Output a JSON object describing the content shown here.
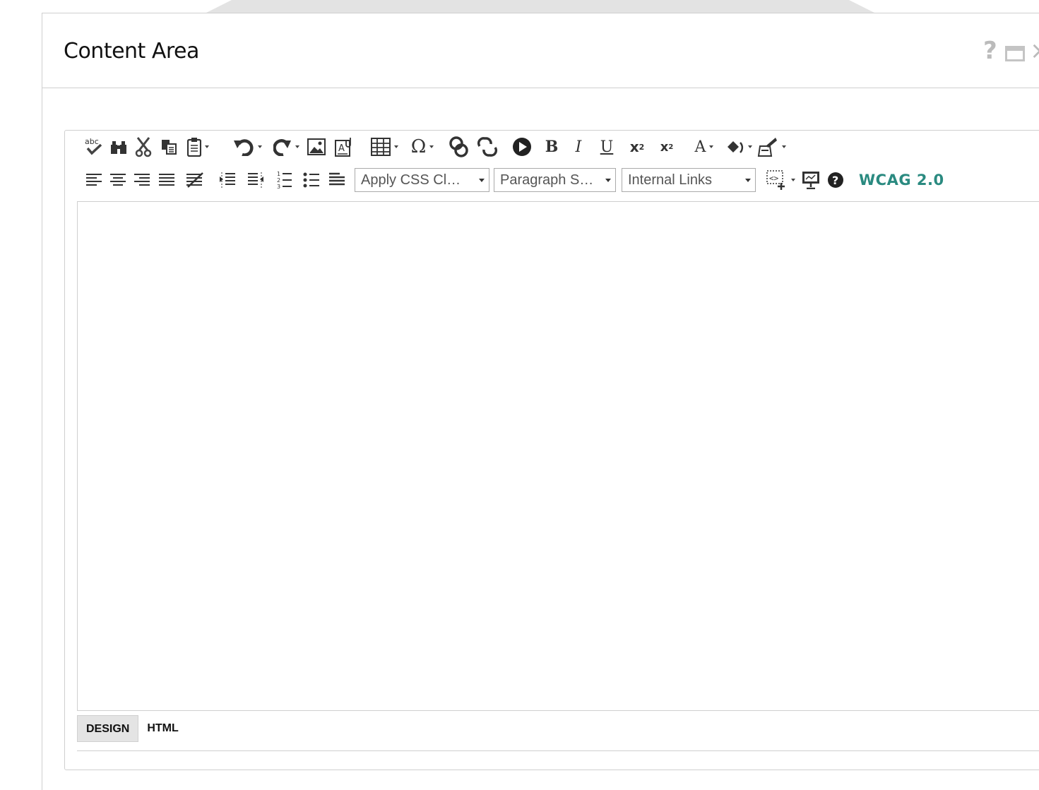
{
  "dialog": {
    "title": "Content Area",
    "help_label": "?",
    "close_label": "×"
  },
  "toolbar": {
    "row1": [
      {
        "name": "spell-check-icon",
        "label": "abc"
      },
      {
        "name": "find-icon"
      },
      {
        "name": "cut-icon"
      },
      {
        "name": "copy-icon"
      },
      {
        "name": "paste-icon",
        "dropdown": true
      },
      {
        "name": "undo-icon",
        "dropdown": true
      },
      {
        "name": "redo-icon",
        "dropdown": true
      },
      {
        "name": "image-icon"
      },
      {
        "name": "document-manager-icon"
      },
      {
        "name": "table-icon",
        "dropdown": true
      },
      {
        "name": "special-character-icon",
        "label": "Ω",
        "dropdown": true
      },
      {
        "name": "link-icon"
      },
      {
        "name": "unlink-icon"
      },
      {
        "name": "media-icon"
      },
      {
        "name": "bold-icon",
        "label": "B"
      },
      {
        "name": "italic-icon",
        "label": "I"
      },
      {
        "name": "underline-icon",
        "label": "U"
      },
      {
        "name": "superscript-icon",
        "label": "x²"
      },
      {
        "name": "subscript-icon",
        "label": "x₂"
      },
      {
        "name": "font-color-icon",
        "label": "A",
        "dropdown": true
      },
      {
        "name": "highlight-icon",
        "dropdown": true
      },
      {
        "name": "format-painter-icon",
        "dropdown": true
      }
    ],
    "row2": [
      {
        "name": "align-left-icon"
      },
      {
        "name": "align-center-icon"
      },
      {
        "name": "align-right-icon"
      },
      {
        "name": "justify-icon"
      },
      {
        "name": "clear-alignment-icon"
      },
      {
        "name": "indent-icon"
      },
      {
        "name": "outdent-icon"
      },
      {
        "name": "numbered-list-icon"
      },
      {
        "name": "bulleted-list-icon"
      },
      {
        "name": "horizontal-rule-icon"
      }
    ],
    "css_class_select": "Apply CSS Cl…",
    "paragraph_style_select": "Paragraph S…",
    "internal_links_select": "Internal Links",
    "insert_snippet_icon": "snippet-icon",
    "preview_icon": "preview-icon",
    "help_icon": "help-icon",
    "wcag_label": "WCAG 2.0"
  },
  "mode_tabs": {
    "design": "DESIGN",
    "html": "HTML"
  }
}
